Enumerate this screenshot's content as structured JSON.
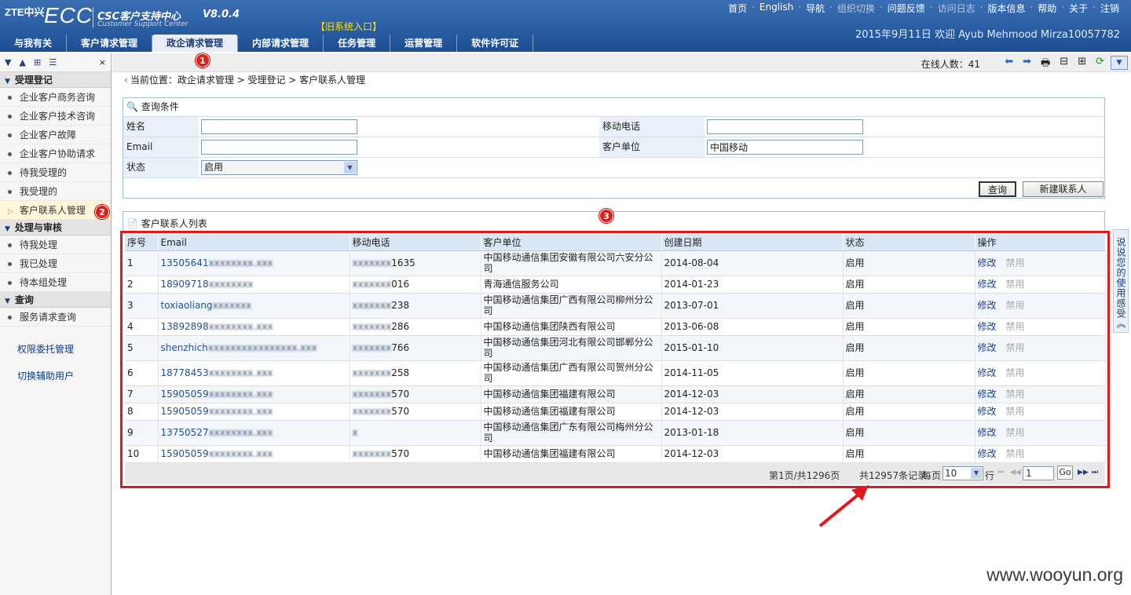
{
  "header": {
    "logo_brand": "ZTE中兴",
    "logo_ecc": "ECC",
    "logo_title": "CSC客户支持中心",
    "logo_subtitle": "Customer Support Center",
    "version": "V8.0.4",
    "old_system": "【旧系统入口】",
    "top_links": [
      "首页",
      "English",
      "导航",
      "组织切换",
      "问题反馈",
      "访问日志",
      "版本信息",
      "帮助",
      "关于",
      "注销"
    ],
    "welcome": "2015年9月11日 欢迎 Ayub Mehmood Mirza10057782"
  },
  "nav": {
    "tabs": [
      "与我有关",
      "客户请求管理",
      "政企请求管理",
      "内部请求管理",
      "任务管理",
      "运营管理",
      "软件许可证"
    ],
    "active_index": 2
  },
  "sidebar": {
    "group1": "受理登记",
    "items1": [
      "企业客户商务咨询",
      "企业客户技术咨询",
      "企业客户故障",
      "企业客户协助请求",
      "待我受理的",
      "我受理的",
      "客户联系人管理"
    ],
    "group2": "处理与审核",
    "items2": [
      "待我处理",
      "我已处理",
      "待本组处理"
    ],
    "group3": "查询",
    "items3": [
      "服务请求查询"
    ],
    "link1": "权限委托管理",
    "link2": "切换辅助用户",
    "close": "×"
  },
  "toolbar": {
    "online": "在线人数：41"
  },
  "breadcrumb": "当前位置：政企请求管理 > 受理登记 > 客户联系人管理",
  "query": {
    "title": "查询条件",
    "name_label": "姓名",
    "name_value": "",
    "mobile_label": "移动电话",
    "mobile_value": "",
    "email_label": "Email",
    "email_value": "",
    "unit_label": "客户单位",
    "unit_value": "中国移动",
    "status_label": "状态",
    "status_value": "启用",
    "search_btn": "查询",
    "new_btn": "新建联系人"
  },
  "list": {
    "title": "客户联系人列表",
    "headers": [
      "序号",
      "Email",
      "移动电话",
      "客户单位",
      "创建日期",
      "状态",
      "操作"
    ],
    "edit": "修改",
    "disable": "禁用",
    "rows": [
      {
        "no": "1",
        "email_a": "13505641",
        "email_b": "xxxxxxxx.xxx",
        "phone_a": "xxxxxxx",
        "phone_b": "1635",
        "unit": "中国移动通信集团安徽有限公司六安分公司",
        "date": "2014-08-04",
        "status": "启用"
      },
      {
        "no": "2",
        "email_a": "18909718",
        "email_b": "xxxxxxxx",
        "phone_a": "xxxxxxx",
        "phone_b": "016",
        "unit": "青海通信服务公司",
        "date": "2014-01-23",
        "status": "启用"
      },
      {
        "no": "3",
        "email_a": "toxiaoliang",
        "email_b": "xxxxxxx",
        "phone_a": "xxxxxxx",
        "phone_b": "238",
        "unit": "中国移动通信集团广西有限公司柳州分公司",
        "date": "2013-07-01",
        "status": "启用"
      },
      {
        "no": "4",
        "email_a": "13892898",
        "email_b": "xxxxxxxx.xxx",
        "phone_a": "xxxxxxx",
        "phone_b": "286",
        "unit": "中国移动通信集团陕西有限公司",
        "date": "2013-06-08",
        "status": "启用"
      },
      {
        "no": "5",
        "email_a": "shenzhich",
        "email_b": "xxxxxxxxxxxxxxxx.xxx",
        "phone_a": "xxxxxxx",
        "phone_b": "766",
        "unit": "中国移动通信集团河北有限公司邯郸分公司",
        "date": "2015-01-10",
        "status": "启用"
      },
      {
        "no": "6",
        "email_a": "18778453",
        "email_b": "xxxxxxxx.xxx",
        "phone_a": "xxxxxxx",
        "phone_b": "258",
        "unit": "中国移动通信集团广西有限公司贺州分公司",
        "date": "2014-11-05",
        "status": "启用"
      },
      {
        "no": "7",
        "email_a": "15905059",
        "email_b": "xxxxxxxx.xxx",
        "phone_a": "xxxxxxx",
        "phone_b": "570",
        "unit": "中国移动通信集团福建有限公司",
        "date": "2014-12-03",
        "status": "启用"
      },
      {
        "no": "8",
        "email_a": "15905059",
        "email_b": "xxxxxxxx.xxx",
        "phone_a": "xxxxxxx",
        "phone_b": "570",
        "unit": "中国移动通信集团福建有限公司",
        "date": "2014-12-03",
        "status": "启用"
      },
      {
        "no": "9",
        "email_a": "13750527",
        "email_b": "xxxxxxxx.xxx",
        "phone_a": "x",
        "phone_b": "",
        "unit": "中国移动通信集团广东有限公司梅州分公司",
        "date": "2013-01-18",
        "status": "启用"
      },
      {
        "no": "10",
        "email_a": "15905059",
        "email_b": "xxxxxxxx.xxx",
        "phone_a": "xxxxxxx",
        "phone_b": "570",
        "unit": "中国移动通信集团福建有限公司",
        "date": "2014-12-03",
        "status": "启用"
      }
    ]
  },
  "pager": {
    "page_info": "第1页/共1296页",
    "total": "共12957条记录",
    "per_page_label": "每页",
    "per_page": "10",
    "rows_label": "行",
    "page_input": "1",
    "go": "Go"
  },
  "feedback": "说说您的使用感受《",
  "badges": [
    "1",
    "2",
    "3"
  ],
  "watermark": "www.wooyun.org",
  "colors": {
    "header": "#2a5da3",
    "highlight_border": "#e0191c",
    "badge": "#d8211b",
    "arrow": "#e0191c"
  }
}
